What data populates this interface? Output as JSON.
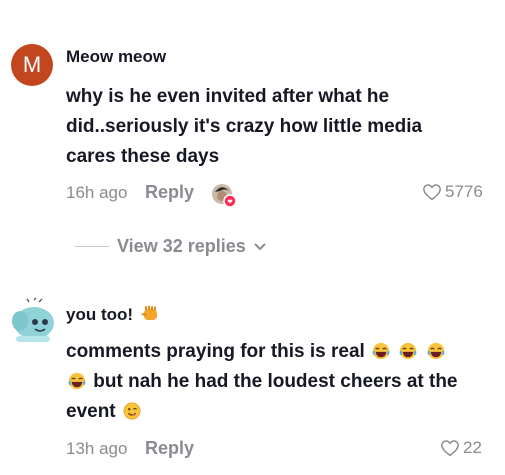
{
  "comments": [
    {
      "avatar_letter": "M",
      "username": "Meow meow",
      "text_lines": [
        "why is he even invited after what he",
        "did..seriously it's crazy how little media",
        "cares these days"
      ],
      "time": "16h ago",
      "reply_label": "Reply",
      "likes": "5776",
      "view_replies": "View 32 replies"
    },
    {
      "username": "you too!",
      "text_line1": "comments praying for this is real",
      "text_line2": "but nah he had the loudest cheers at the",
      "text_line3": "event",
      "time": "13h ago",
      "reply_label": "Reply",
      "likes": "22"
    }
  ],
  "icons": {
    "heart": "heart-icon",
    "chevron": "chevron-down-icon",
    "laugh_emoji": "laughing-emoji-icon",
    "wink_emoji": "wink-emoji-icon",
    "fist_emoji": "fist-emoji-icon"
  },
  "colors": {
    "avatar_bg": "#c2461e",
    "muted_text": "#8a8b91",
    "primary_text": "#161823"
  }
}
